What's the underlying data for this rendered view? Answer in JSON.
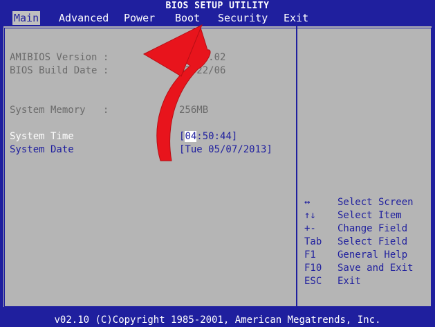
{
  "title": "BIOS SETUP UTILITY",
  "menu": [
    "Main",
    "Advanced",
    "Power",
    "Boot",
    "Security",
    "Exit"
  ],
  "main": {
    "amibios_label": "AMIBIOS Version :",
    "amibios_value": "08.00.02",
    "build_date_label": "BIOS Build Date :",
    "build_date_value": "02/22/06",
    "memory_label": "System Memory   :",
    "memory_value": "256MB",
    "time_label": "System Time",
    "time_hl": "04",
    "time_rest": ":50:44]",
    "time_open": "[",
    "date_label": "System Date",
    "date_value": "[Tue 05/07/2013]"
  },
  "help": [
    {
      "key": "↔",
      "desc": "Select Screen"
    },
    {
      "key": "↑↓",
      "desc": "Select Item"
    },
    {
      "key": "+-",
      "desc": "Change Field"
    },
    {
      "key": "Tab",
      "desc": "Select Field"
    },
    {
      "key": "F1",
      "desc": "General Help"
    },
    {
      "key": "F10",
      "desc": "Save and Exit"
    },
    {
      "key": "ESC",
      "desc": "Exit"
    }
  ],
  "footer": "v02.10 (C)Copyright 1985-2001, American Megatrends, Inc.",
  "colors": {
    "background": "#1f1f9e",
    "panel": "#b5b5b5",
    "arrow": "#e8141c"
  }
}
